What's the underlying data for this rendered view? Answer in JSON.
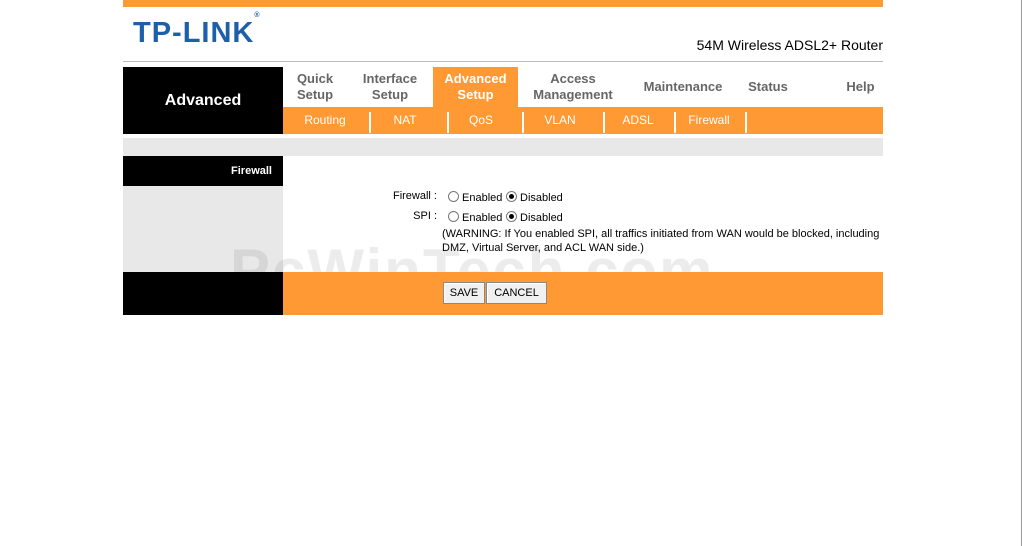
{
  "brand": {
    "logo_text": "TP-LINK",
    "registered": "®",
    "product": "54M Wireless ADSL2+ Router"
  },
  "nav": {
    "section_label": "Advanced",
    "tabs": [
      {
        "label_line1": "Quick",
        "label_line2": "Setup"
      },
      {
        "label_line1": "Interface",
        "label_line2": "Setup"
      },
      {
        "label_line1": "Advanced",
        "label_line2": "Setup",
        "active": true
      },
      {
        "label_line1": "Access",
        "label_line2": "Management"
      },
      {
        "label_line1": "Maintenance",
        "label_line2": ""
      },
      {
        "label_line1": "Status",
        "label_line2": ""
      },
      {
        "label_line1": "Help",
        "label_line2": ""
      }
    ],
    "subtabs": [
      "Routing",
      "NAT",
      "QoS",
      "VLAN",
      "ADSL",
      "Firewall"
    ]
  },
  "sidebar": {
    "title": "Firewall"
  },
  "form": {
    "firewall_label": "Firewall :",
    "spi_label": "SPI :",
    "enabled_label": "Enabled",
    "disabled_label": "Disabled",
    "firewall_value": "Disabled",
    "spi_value": "Disabled",
    "warning": "(WARNING: If You enabled SPI, all traffics initiated from WAN would be blocked, including DMZ, Virtual Server, and ACL WAN side.)"
  },
  "buttons": {
    "save": "SAVE",
    "cancel": "CANCEL"
  },
  "watermark": "PcWinTech.com",
  "colors": {
    "accent": "#ff9933",
    "logo": "#1d5fa8"
  }
}
